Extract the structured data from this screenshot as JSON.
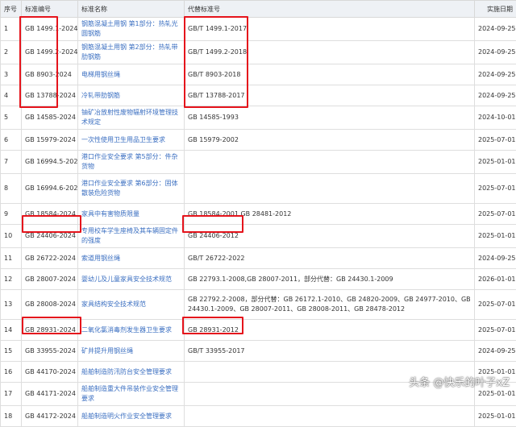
{
  "headers": [
    "序号",
    "标准编号",
    "标准名称",
    "代替标准号",
    "实施日期"
  ],
  "rows": [
    {
      "no": "1",
      "code": "GB 1499.1-2024",
      "name": "钢筋混凝土用钢 第1部分：热轧光圆钢筋",
      "replaces": "GB/T 1499.1-2017",
      "date": "2024-09-25"
    },
    {
      "no": "2",
      "code": "GB 1499.2-2024",
      "name": "钢筋混凝土用钢 第2部分：热轧带肋钢筋",
      "replaces": "GB/T 1499.2-2018",
      "date": "2024-09-25"
    },
    {
      "no": "3",
      "code": "GB 8903-2024",
      "name": "电梯用钢丝绳",
      "replaces": "GB/T 8903-2018",
      "date": "2024-09-25"
    },
    {
      "no": "4",
      "code": "GB 13788-2024",
      "name": "冷轧带肋钢筋",
      "replaces": "GB/T 13788-2017",
      "date": "2024-09-25"
    },
    {
      "no": "5",
      "code": "GB 14585-2024",
      "name": "铀矿冶放射性废物辐射环境管理技术规定",
      "replaces": "GB 14585-1993",
      "date": "2024-10-01"
    },
    {
      "no": "6",
      "code": "GB 15979-2024",
      "name": "一次性使用卫生用品卫生要求",
      "replaces": "GB 15979-2002",
      "date": "2025-07-01"
    },
    {
      "no": "7",
      "code": "GB 16994.5-2024",
      "name": "港口作业安全要求 第5部分：件杂货物",
      "replaces": "",
      "date": "2025-01-01"
    },
    {
      "no": "8",
      "code": "GB 16994.6-2024",
      "name": "港口作业安全要求 第6部分：固体散装危险货物",
      "replaces": "",
      "date": "2025-07-01"
    },
    {
      "no": "9",
      "code": "GB 18584-2024",
      "name": "家具中有害物质限量",
      "replaces": "GB 18584-2001,GB 28481-2012",
      "date": "2025-07-01"
    },
    {
      "no": "10",
      "code": "GB 24406-2024",
      "name": "专用校车学生座椅及其车辆固定件的强度",
      "replaces": "GB 24406-2012",
      "date": "2025-01-01"
    },
    {
      "no": "11",
      "code": "GB 26722-2024",
      "name": "索道用钢丝绳",
      "replaces": "GB/T 26722-2022",
      "date": "2024-09-25"
    },
    {
      "no": "12",
      "code": "GB 28007-2024",
      "name": "婴幼儿及儿童家具安全技术规范",
      "replaces": "GB 22793.1-2008,GB 28007-2011，部分代替：GB 24430.1-2009",
      "date": "2026-01-01"
    },
    {
      "no": "13",
      "code": "GB 28008-2024",
      "name": "家具结构安全技术规范",
      "replaces": "GB 22792.2-2008，部分代替：GB 26172.1-2010、GB 24820-2009、GB 24977-2010、GB 24430.1-2009、GB 28007-2011、GB 28008-2011、GB 28478-2012",
      "date": "2025-07-01"
    },
    {
      "no": "14",
      "code": "GB 28931-2024",
      "name": "二氧化氯消毒剂发生器卫生要求",
      "replaces": "GB 28931-2012",
      "date": "2025-07-01"
    },
    {
      "no": "15",
      "code": "GB 33955-2024",
      "name": "矿井提升用钢丝绳",
      "replaces": "GB/T 33955-2017",
      "date": "2024-09-25"
    },
    {
      "no": "16",
      "code": "GB 44170-2024",
      "name": "船舶制造防汛防台安全管理要求",
      "replaces": "",
      "date": "2025-01-01"
    },
    {
      "no": "17",
      "code": "GB 44171-2024",
      "name": "船舶制造重大件吊装作业安全管理要求",
      "replaces": "",
      "date": "2025-01-01"
    },
    {
      "no": "18",
      "code": "GB 44172-2024",
      "name": "船舶制造明火作业安全管理要求",
      "replaces": "",
      "date": "2025-01-01"
    }
  ],
  "watermark": "头条 @快乐的叶子xZ",
  "colors": {
    "highlight": "#e5141c",
    "link": "#3b6fc1",
    "header_bg": "#eef1f5"
  }
}
